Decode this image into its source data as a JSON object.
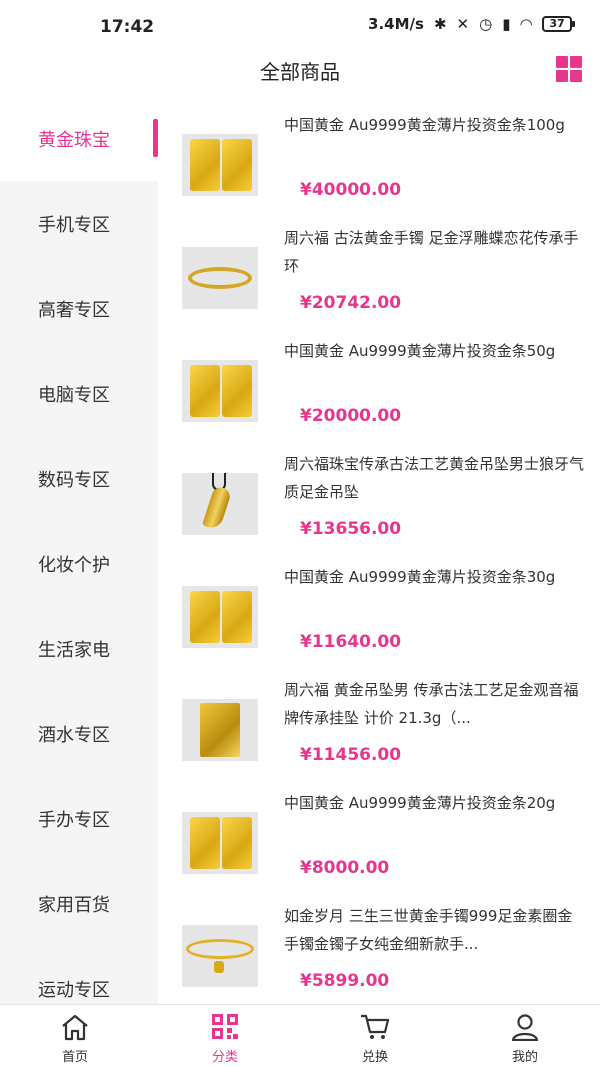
{
  "status_bar": {
    "time": "17:42",
    "speed": "3.4M/s",
    "battery": "37"
  },
  "header": {
    "title": "全部商品"
  },
  "sidebar": {
    "items": [
      {
        "label": "黄金珠宝"
      },
      {
        "label": "手机专区"
      },
      {
        "label": "高奢专区"
      },
      {
        "label": "电脑专区"
      },
      {
        "label": "数码专区"
      },
      {
        "label": "化妆个护"
      },
      {
        "label": "生活家电"
      },
      {
        "label": "酒水专区"
      },
      {
        "label": "手办专区"
      },
      {
        "label": "家用百货"
      },
      {
        "label": "运动专区"
      }
    ],
    "active_index": 0
  },
  "products": [
    {
      "name": "中国黄金 Au9999黄金薄片投资金条100g",
      "price": "¥40000.00",
      "image": "gold-bar"
    },
    {
      "name": "周六福 古法黄金手镯 足金浮雕蝶恋花传承手环",
      "price": "¥20742.00",
      "image": "bangle"
    },
    {
      "name": "中国黄金 Au9999黄金薄片投资金条50g",
      "price": "¥20000.00",
      "image": "gold-bar"
    },
    {
      "name": "周六福珠宝传承古法工艺黄金吊坠男士狼牙气质足金吊坠",
      "price": "¥13656.00",
      "image": "pendant"
    },
    {
      "name": "中国黄金 Au9999黄金薄片投资金条30g",
      "price": "¥11640.00",
      "image": "gold-bar"
    },
    {
      "name": "周六福 黄金吊坠男 传承古法工艺足金观音福牌传承挂坠 计价 21.3g（...",
      "price": "¥11456.00",
      "image": "plaque"
    },
    {
      "name": "中国黄金 Au9999黄金薄片投资金条20g",
      "price": "¥8000.00",
      "image": "gold-bar"
    },
    {
      "name": "如金岁月 三生三世黄金手镯999足金素圈金手镯金镯子女纯金细新款手...",
      "price": "¥5899.00",
      "image": "bangle-charm"
    }
  ],
  "tabbar": {
    "tabs": [
      {
        "label": "首页",
        "icon": "home-icon"
      },
      {
        "label": "分类",
        "icon": "category-icon"
      },
      {
        "label": "兑换",
        "icon": "cart-icon"
      },
      {
        "label": "我的",
        "icon": "user-icon"
      }
    ],
    "active_index": 1
  },
  "colors": {
    "accent": "#e8368f",
    "sidebar_bg": "#f5f5f5"
  }
}
